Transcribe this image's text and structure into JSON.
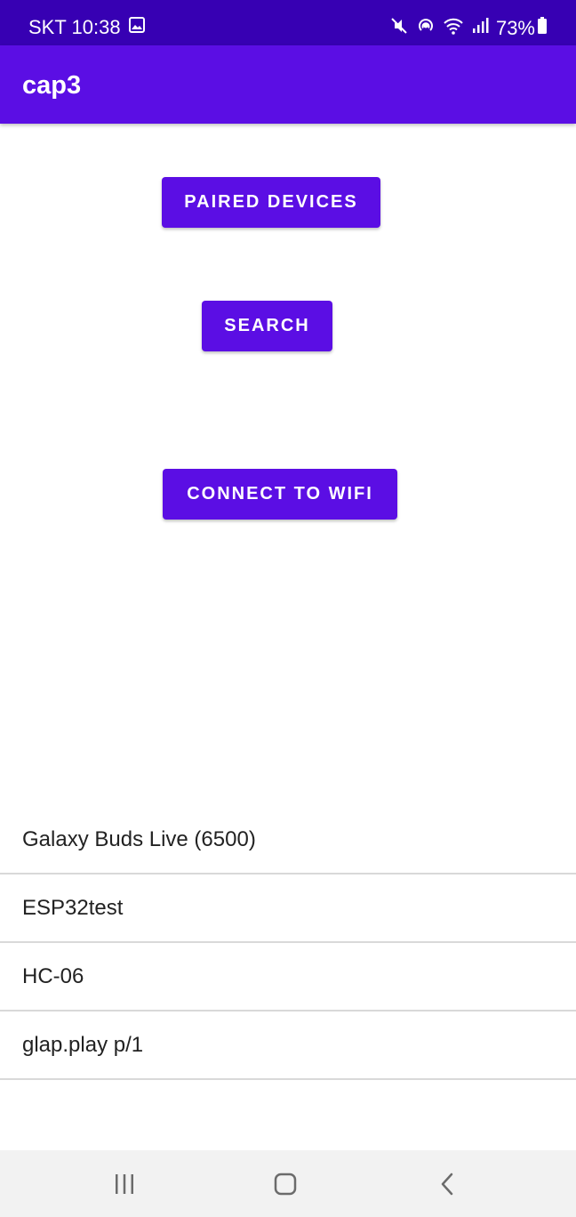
{
  "status_bar": {
    "carrier_time": "SKT 10:38",
    "battery": "73%",
    "icons": [
      "gallery-icon",
      "mute-icon",
      "hotspot-icon",
      "wifi-icon",
      "signal-icon",
      "battery-icon"
    ]
  },
  "app_bar": {
    "title": "cap3"
  },
  "buttons": {
    "paired_devices": "PAIRED DEVICES",
    "search": "SEARCH",
    "connect_wifi": "CONNECT TO WIFI"
  },
  "devices": [
    {
      "name": "Galaxy Buds Live (6500)"
    },
    {
      "name": "ESP32test"
    },
    {
      "name": "HC-06"
    },
    {
      "name": "glap.play p/1"
    }
  ],
  "nav_bar": {
    "icons": [
      "recents-icon",
      "home-icon",
      "back-icon"
    ]
  },
  "colors": {
    "status_bar": "#3700b3",
    "primary": "#5b0ee4",
    "divider": "#d9d9d9",
    "nav_bar": "#f2f2f2"
  }
}
